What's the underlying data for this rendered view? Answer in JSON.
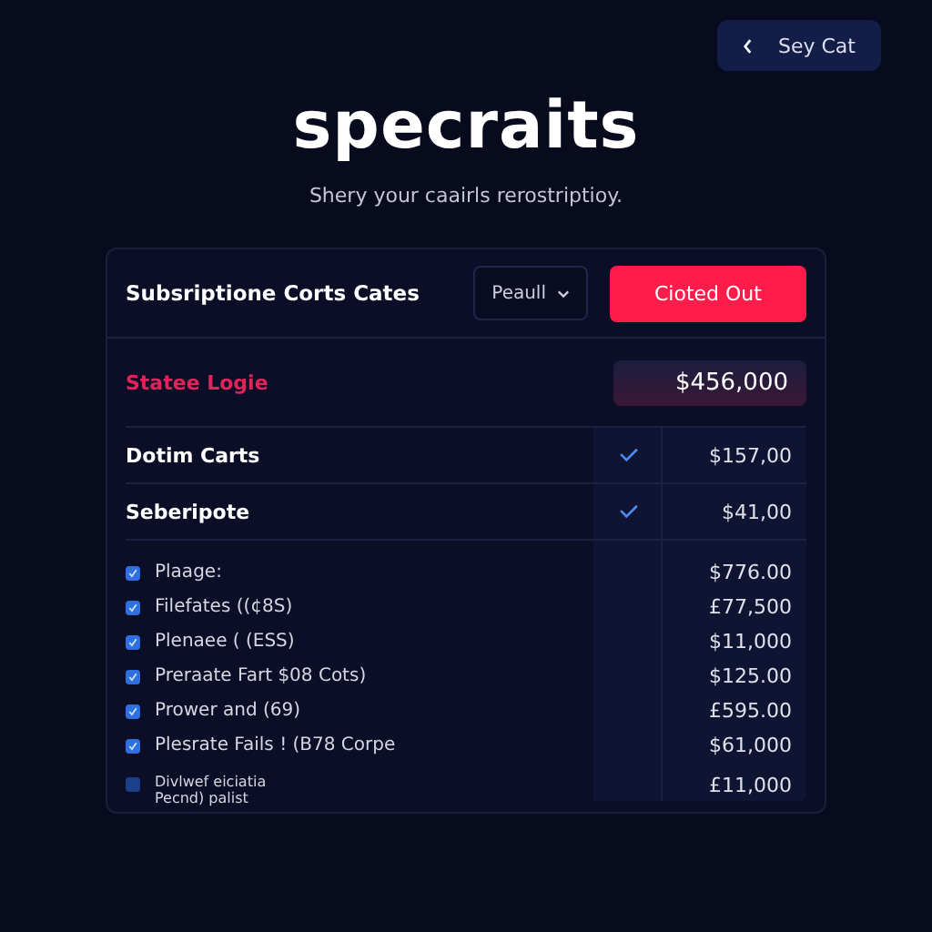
{
  "back_button": {
    "label": "Sey Cat"
  },
  "title": "specraits",
  "subtitle": "Shery your caairls rerostriptioy.",
  "card": {
    "title": "Subsriptione Corts Cates",
    "dropdown": {
      "value": "Peaull"
    },
    "action_button": "Cioted Out",
    "total": {
      "label": "Statee Logie",
      "value": "$456,000"
    },
    "plans": [
      {
        "name": "Dotim Carts",
        "checked": true,
        "price": "$157,00"
      },
      {
        "name": "Seberipote",
        "checked": true,
        "price": "$41,00"
      }
    ],
    "items": [
      {
        "label": "Plaage:",
        "checked": true,
        "price": "$776.00"
      },
      {
        "label": "Filefates ((¢8S)",
        "checked": true,
        "price": "£77,500"
      },
      {
        "label": "Plenaee ( (ESS)",
        "checked": true,
        "price": "$11,000"
      },
      {
        "label": "Preraate Fart $08 Cots)",
        "checked": true,
        "price": "$125.00"
      },
      {
        "label": "Prower and (69)",
        "checked": true,
        "price": "£595.00"
      },
      {
        "label": "Plesrate Fails ! (B78 Corpe",
        "checked": true,
        "price": "$61,000"
      },
      {
        "label": "Divlwef eiciatia",
        "note": "Pecnd) palist",
        "checked": false,
        "price": "£11,000"
      }
    ]
  }
}
